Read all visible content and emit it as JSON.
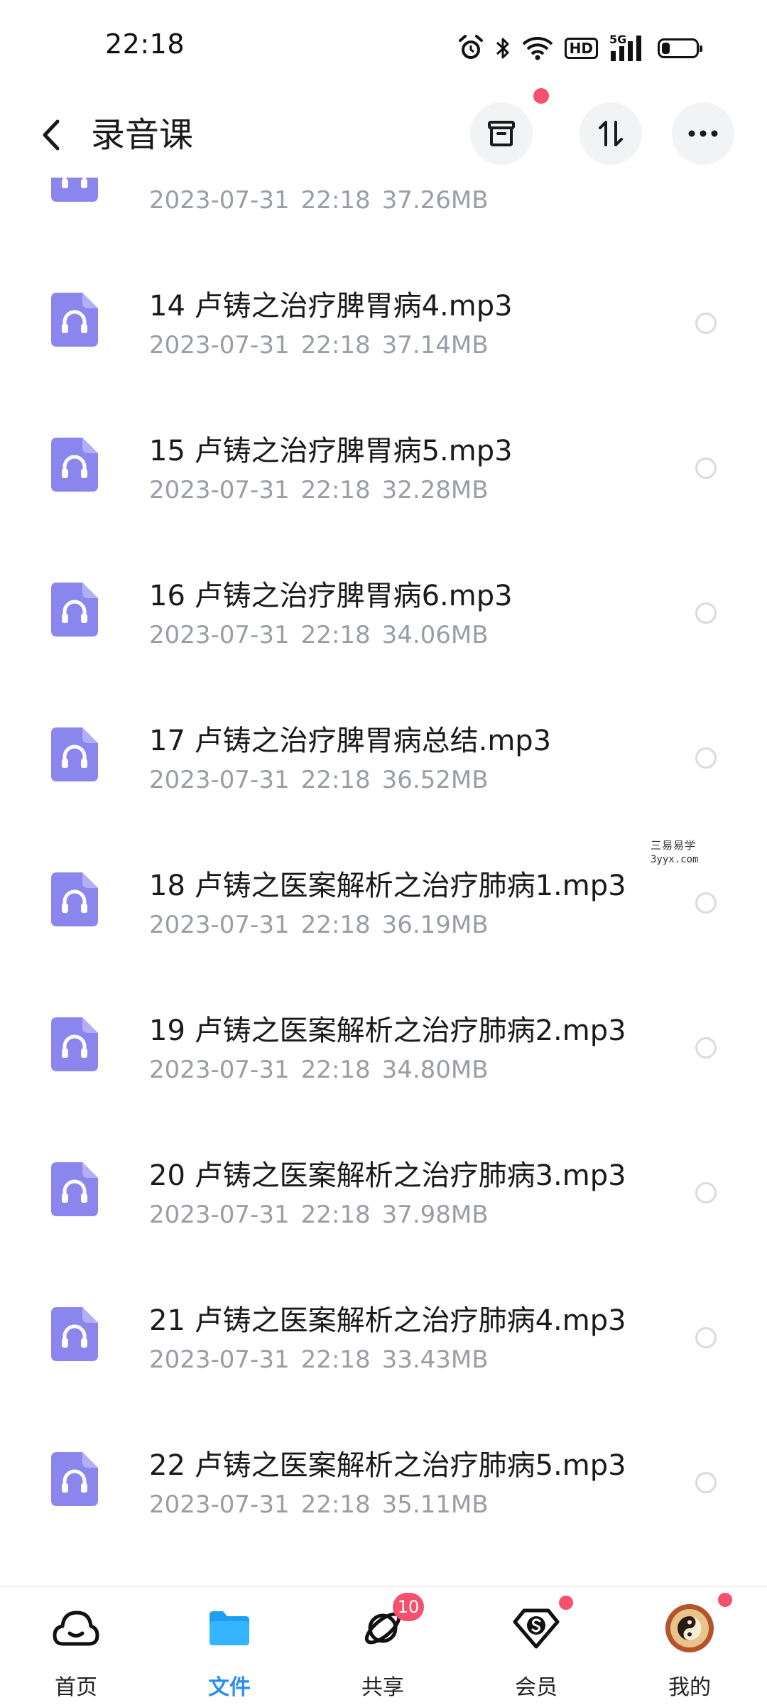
{
  "status_bar": {
    "time": "22:18",
    "icons": [
      "alarm-icon",
      "bluetooth-icon",
      "wifi-icon",
      "hd-icon",
      "5g-signal-icon",
      "battery-icon"
    ],
    "hd_label": "HD",
    "network_label": "5G",
    "battery_level": 0.22
  },
  "header": {
    "title": "录音课",
    "buttons": [
      "archive-icon",
      "sort-icon",
      "more-icon"
    ]
  },
  "files": [
    {
      "name": "",
      "date": "2023-07-31",
      "time": "22:18",
      "size": "37.26MB",
      "partial": true
    },
    {
      "name": "14 卢铸之治疗脾胃病4.mp3",
      "date": "2023-07-31",
      "time": "22:18",
      "size": "37.14MB"
    },
    {
      "name": "15 卢铸之治疗脾胃病5.mp3",
      "date": "2023-07-31",
      "time": "22:18",
      "size": "32.28MB"
    },
    {
      "name": "16 卢铸之治疗脾胃病6.mp3",
      "date": "2023-07-31",
      "time": "22:18",
      "size": "34.06MB"
    },
    {
      "name": "17 卢铸之治疗脾胃病总结.mp3",
      "date": "2023-07-31",
      "time": "22:18",
      "size": "36.52MB"
    },
    {
      "name": "18 卢铸之医案解析之治疗肺病1.mp3",
      "date": "2023-07-31",
      "time": "22:18",
      "size": "36.19MB"
    },
    {
      "name": "19 卢铸之医案解析之治疗肺病2.mp3",
      "date": "2023-07-31",
      "time": "22:18",
      "size": "34.80MB"
    },
    {
      "name": "20 卢铸之医案解析之治疗肺病3.mp3",
      "date": "2023-07-31",
      "time": "22:18",
      "size": "37.98MB"
    },
    {
      "name": "21 卢铸之医案解析之治疗肺病4.mp3",
      "date": "2023-07-31",
      "time": "22:18",
      "size": "33.43MB"
    },
    {
      "name": "22 卢铸之医案解析之治疗肺病5.mp3",
      "date": "2023-07-31",
      "time": "22:18",
      "size": "35.11MB"
    }
  ],
  "watermark": {
    "line1": "三易易学",
    "line2": "3yyx.com"
  },
  "bottom_nav": {
    "items": [
      {
        "label": "首页",
        "icon": "cloud-home-icon",
        "active": false
      },
      {
        "label": "文件",
        "icon": "folder-icon",
        "active": true
      },
      {
        "label": "共享",
        "icon": "share-orbit-icon",
        "active": false,
        "badge": "10"
      },
      {
        "label": "会员",
        "icon": "vip-diamond-icon",
        "active": false,
        "dot": true
      },
      {
        "label": "我的",
        "icon": "avatar",
        "active": false,
        "dot": true
      }
    ]
  },
  "colors": {
    "accent": "#2a8df0",
    "file_icon": "#8b86ee",
    "badge": "#f5506e",
    "meta_text": "#9a9da6"
  }
}
